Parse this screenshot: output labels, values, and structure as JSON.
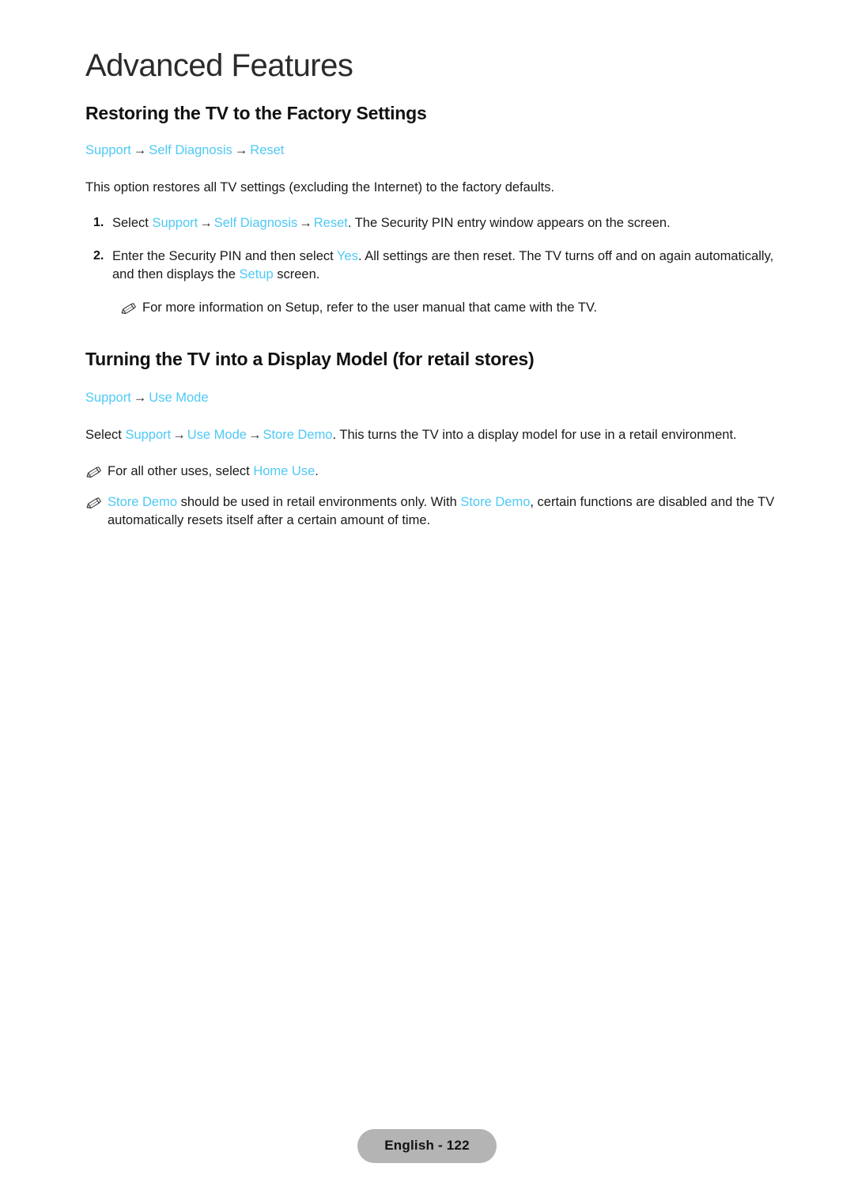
{
  "page": {
    "chapter_title": "Advanced Features",
    "language_footer": "English - 122",
    "link_color": "#4FC9F5",
    "badge_color": "#b4b4b4"
  },
  "sections": [
    {
      "heading": "Restoring the TV to the Factory Settings",
      "breadcrumb": {
        "item1": "Support",
        "arrow1": "→",
        "item2": "Self Diagnosis",
        "arrow2": "→",
        "item3": "Reset"
      },
      "intro": "This option restores all TV settings (excluding the Internet) to the factory defaults.",
      "steps": [
        {
          "number": "1.",
          "lead": "Select ",
          "mi1": "Support",
          "arrow1": "→",
          "mi2": "Self Diagnosis",
          "arrow2": "→",
          "mi3": "Reset",
          "tail": ". The Security PIN entry window appears on the screen."
        },
        {
          "number": "2.",
          "lead": "Enter the Security PIN and then select ",
          "mi1": "Yes",
          "mid": ". All settings are then reset. The TV turns off and on again automatically, and then displays the ",
          "mi2": "Setup",
          "tail": " screen."
        }
      ],
      "notes": [
        {
          "icon": "pencil-icon",
          "text": "For more information on Setup, refer to the user manual that came with the TV.",
          "indented": true
        }
      ]
    },
    {
      "heading": "Turning the TV into a Display Model (for retail stores)",
      "breadcrumb": {
        "item1": "Support",
        "arrow1": "→",
        "item2": "Use Mode"
      },
      "body": {
        "lead": "Select ",
        "mi1": "Support",
        "arrow1": "→",
        "mi2": "Use Mode",
        "arrow2": "→",
        "mi3": "Store Demo",
        "tail": ". This turns the TV into a display model for use in a retail environment."
      },
      "notes": [
        {
          "icon": "pencil-icon",
          "lead": "For all other uses, select ",
          "mi1": "Home Use",
          "tail": "."
        },
        {
          "icon": "pencil-icon",
          "mi1": "Store Demo",
          "mid": " should be used in retail environments only. With ",
          "mi2": "Store Demo",
          "tail": ", certain functions are disabled and the TV automatically resets itself after a certain amount of time."
        }
      ]
    }
  ]
}
